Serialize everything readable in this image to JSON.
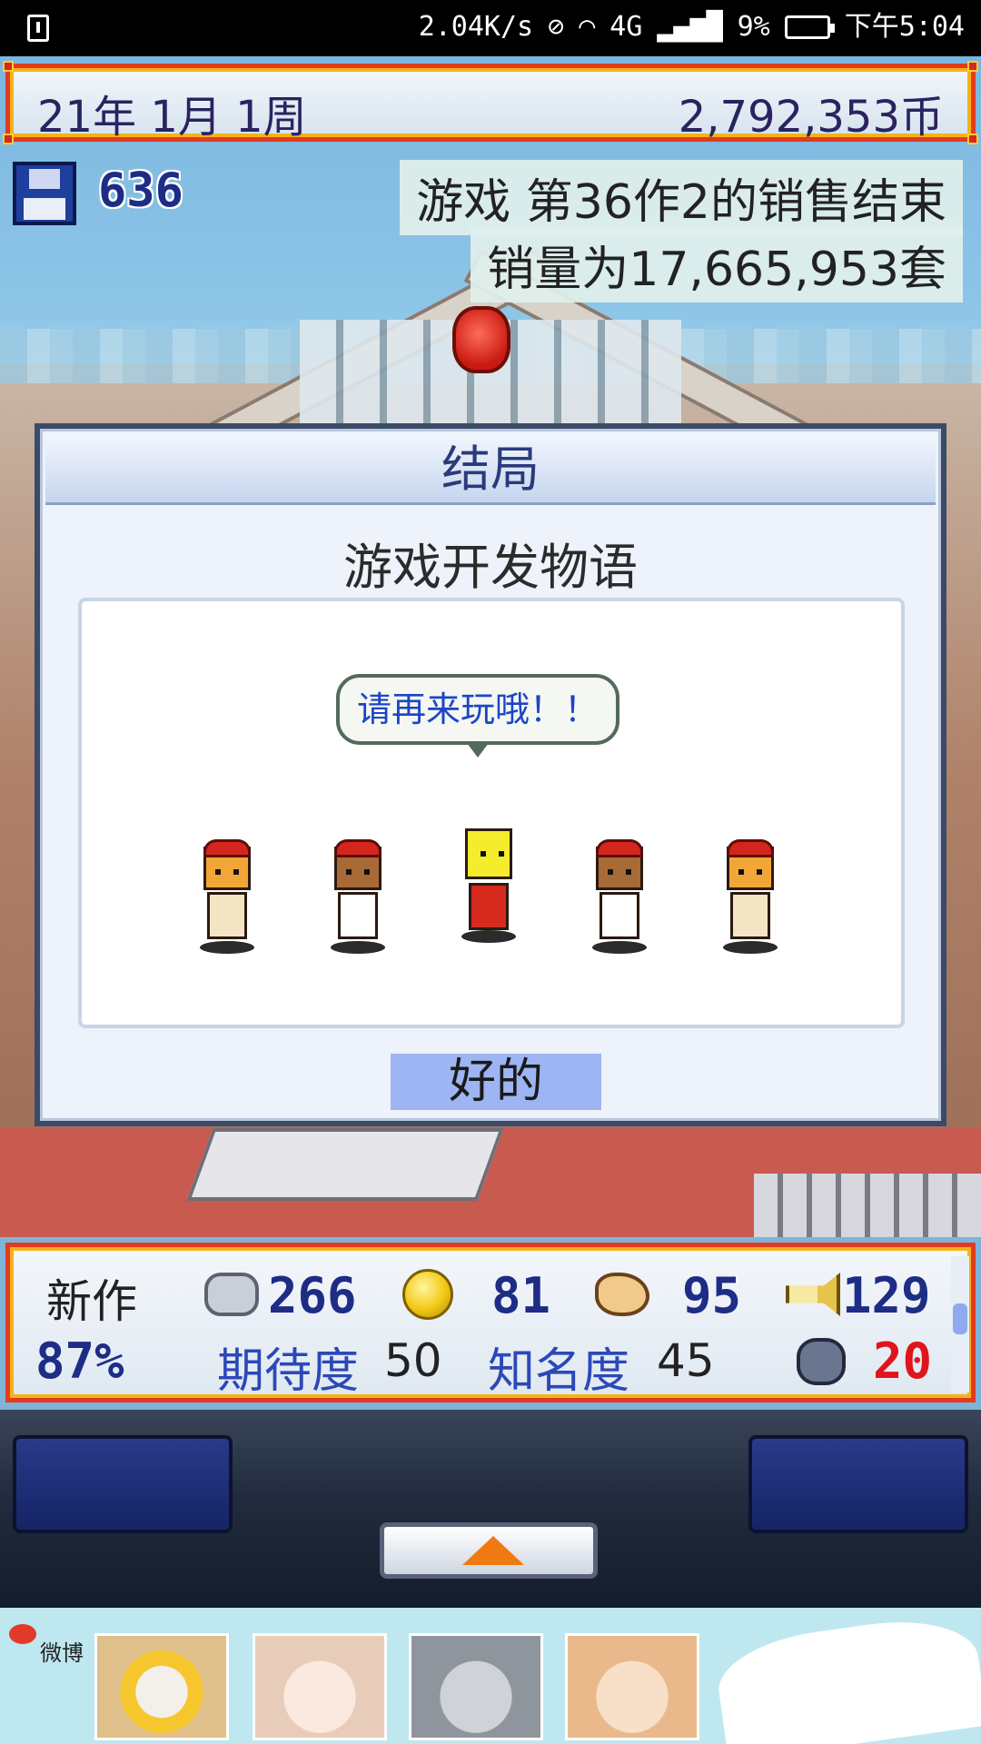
{
  "status_bar": {
    "net_speed": "2.04K/s",
    "network": "4G",
    "battery": "9%",
    "time": "下午5:04",
    "mute_icon": "mute-icon",
    "wifi_icon": "wifi-icon",
    "signal_icon": "signal-icon"
  },
  "hud_top": {
    "date": "21年 1月 1周",
    "money": "2,792,353币"
  },
  "disk_count": "636",
  "notices": {
    "line1": "游戏 第36作2的销售结束",
    "line2": "销量为17,665,953套"
  },
  "dialog": {
    "title": "结局",
    "subtitle": "游戏开发物语",
    "speech": "请再来玩哦！！",
    "ok_label": "好的"
  },
  "stats": {
    "new_work_label": "新作",
    "progress": "87%",
    "fun": "266",
    "creativity": "81",
    "graphics": "95",
    "sound": "129",
    "anticipation_label": "期待度",
    "anticipation_value": "50",
    "fame_label": "知名度",
    "fame_value": "45",
    "bugs": "20"
  },
  "colors": {
    "hud_border": "#e33b1e",
    "hud_trim": "#f5b21a",
    "dialog_button": "#9db5f2",
    "speech_text": "#1c45c6",
    "bug_count": "#e0141a"
  },
  "ad": {
    "brand": "微博"
  }
}
